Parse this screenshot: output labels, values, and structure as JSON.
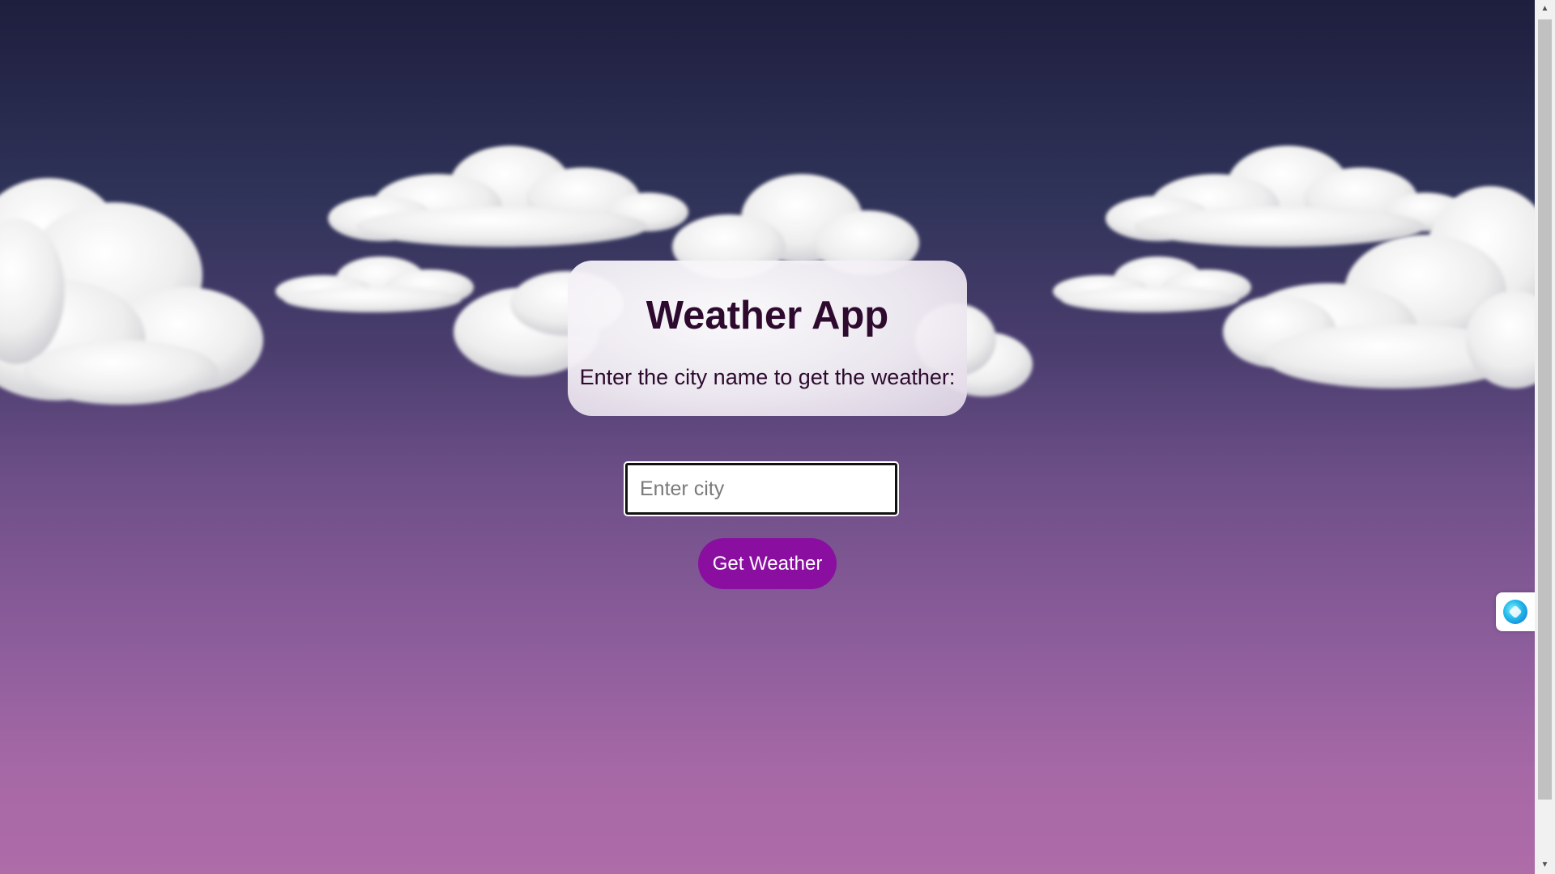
{
  "app": {
    "title": "Weather App",
    "subtitle": "Enter the city name to get the weather:"
  },
  "search": {
    "placeholder": "Enter city",
    "value": ""
  },
  "actions": {
    "get_weather_label": "Get Weather"
  },
  "colors": {
    "sky_top": "#1e1e3e",
    "sky_bottom": "#ae6ca8",
    "title_text": "#2d0a2e",
    "button_bg": "#8a0fa0",
    "button_text": "#ffffff"
  },
  "icons": {
    "extension_widget": "extension-orb-icon",
    "scroll_up": "chevron-up-icon",
    "scroll_down": "chevron-down-icon"
  }
}
